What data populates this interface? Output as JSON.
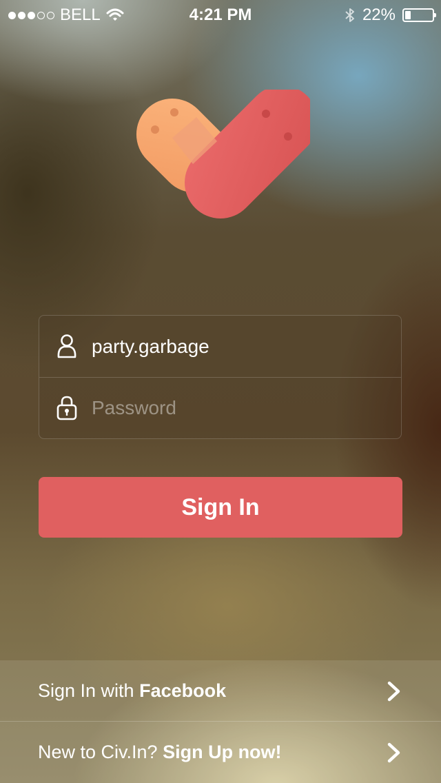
{
  "status_bar": {
    "carrier": "BELL",
    "time": "4:21 PM",
    "battery_percent_label": "22%",
    "battery_level": 0.22,
    "signal_strength": 3,
    "signal_max": 5
  },
  "login": {
    "username": {
      "value": "party.garbage",
      "icon": "user-icon"
    },
    "password": {
      "value": "",
      "placeholder": "Password",
      "icon": "lock-icon"
    },
    "sign_in_label": "Sign In"
  },
  "links": {
    "facebook": {
      "prefix": "Sign In with",
      "strong": "Facebook"
    },
    "signup": {
      "prefix": "New to Civ.In?",
      "strong": "Sign Up now!"
    }
  },
  "colors": {
    "accent": "#e06060",
    "logo_orange": "#f8aa72",
    "logo_red": "#e05e5e"
  },
  "icons": [
    "wifi-icon",
    "bluetooth-icon",
    "battery-icon",
    "user-icon",
    "lock-icon",
    "chevron-right-icon",
    "app-logo"
  ]
}
